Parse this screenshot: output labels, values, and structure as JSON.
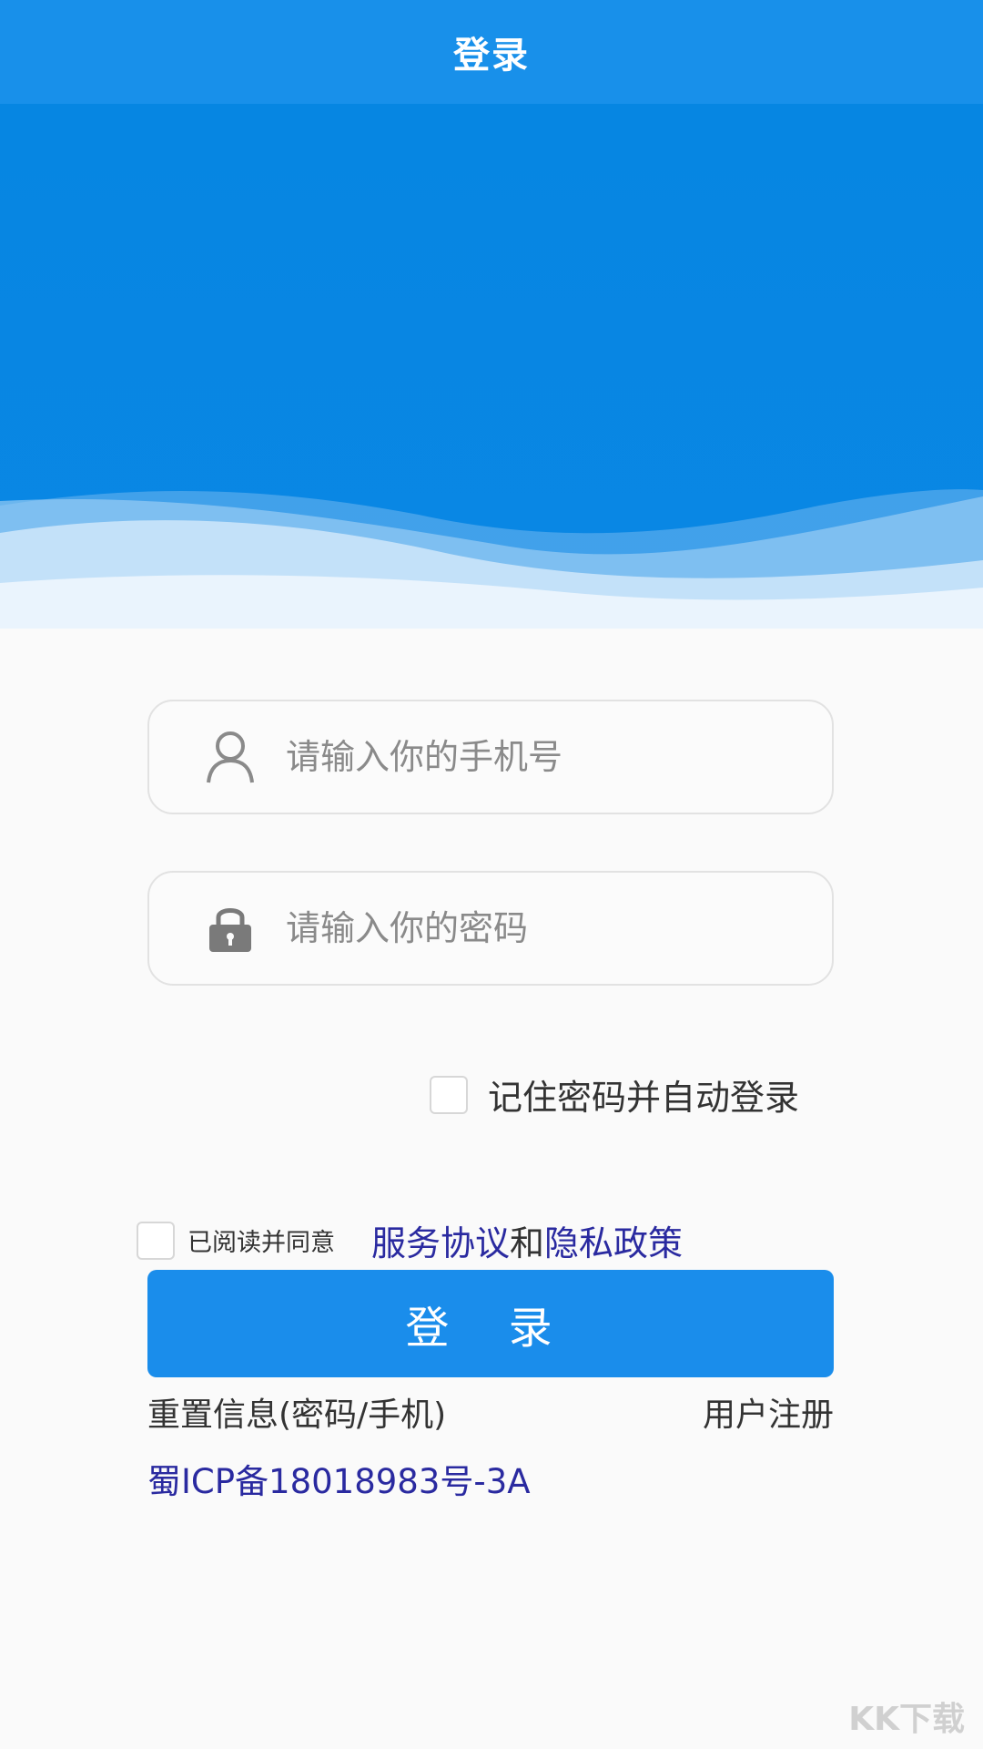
{
  "header": {
    "title": "登录"
  },
  "login": {
    "phone_placeholder": "请输入你的手机号",
    "password_placeholder": "请输入你的密码",
    "remember_label": "记住密码并自动登录",
    "agree_label": "已阅读并同意",
    "service_link": "服务协议",
    "and_text": "和",
    "privacy_link": "隐私政策",
    "login_button": "登 录",
    "reset_link": "重置信息(密码/手机)",
    "register_link": "用户注册",
    "icp": "蜀ICP备18018983号-3A"
  },
  "watermark": "KK下载",
  "colors": {
    "primary": "#1890ea",
    "banner": "#0686e2",
    "link": "#2a2aa0"
  }
}
